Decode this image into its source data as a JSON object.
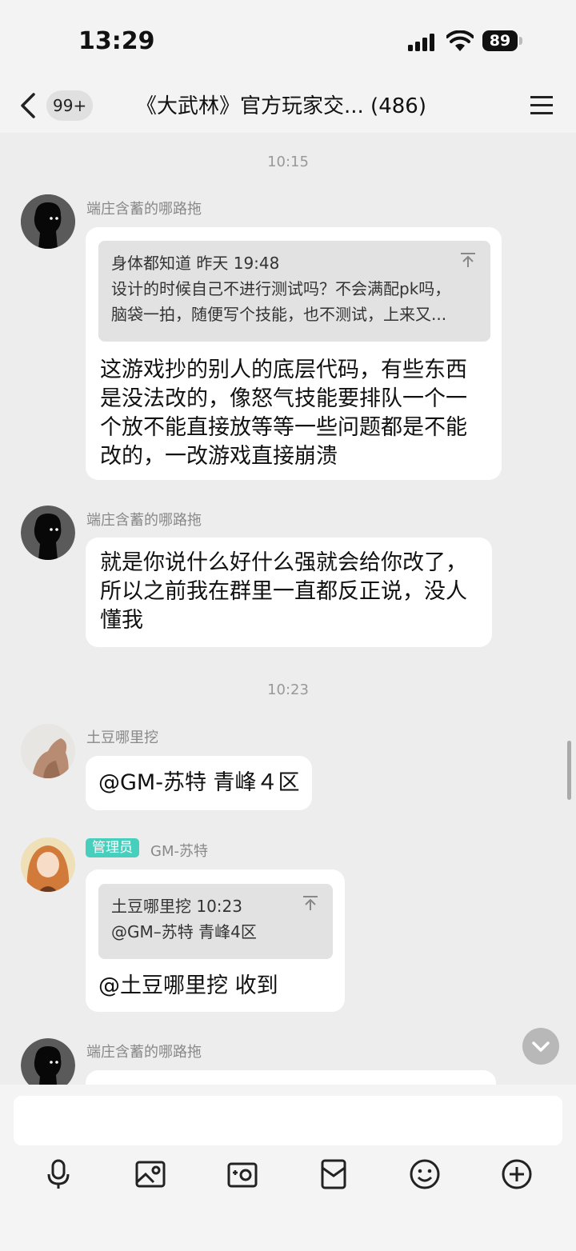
{
  "status_bar": {
    "time": "13:29",
    "battery": "89"
  },
  "nav": {
    "unread_badge": "99+",
    "title": "《大武林》官方玩家交... (486)"
  },
  "timestamps": [
    "10:15",
    "10:23"
  ],
  "messages": [
    {
      "sender": "端庄含蓄的哪路拖",
      "quote": {
        "header": "身体都知道 昨天 19:48",
        "line1": "设计的时候自己不进行测试吗？不会满配pk吗，",
        "line2": "脑袋一拍，随便写个技能，也不测试，上来又..."
      },
      "lines": [
        "这游戏抄的别人的底层代码，有些东西",
        "是没法改的，像怒气技能要排队一个一",
        "个放不能直接放等等一些问题都是不能",
        "改的，一改游戏直接崩溃"
      ]
    },
    {
      "sender": "端庄含蓄的哪路拖",
      "lines": [
        "就是你说什么好什么强就会给你改了，",
        "所以之前我在群里一直都反正说，没人",
        "懂我"
      ]
    },
    {
      "sender": "土豆哪里挖",
      "lines": [
        "@GM-苏特 青峰４区"
      ]
    },
    {
      "sender": "GM-苏特",
      "role": "管理员",
      "quote": {
        "header": "土豆哪里挖 10:23",
        "line1": "@GM–苏特  青峰4区"
      },
      "lines": [
        "@土豆哪里挖 收到"
      ]
    },
    {
      "sender": "端庄含蓄的哪路拖"
    }
  ],
  "colors": {
    "background": "#ededed",
    "bubble": "#ffffff",
    "admin_tag": "#46cfbd"
  },
  "toolbar_icons": [
    "microphone-icon",
    "image-icon",
    "camera-icon",
    "red-packet-icon",
    "emoji-icon",
    "plus-icon"
  ]
}
